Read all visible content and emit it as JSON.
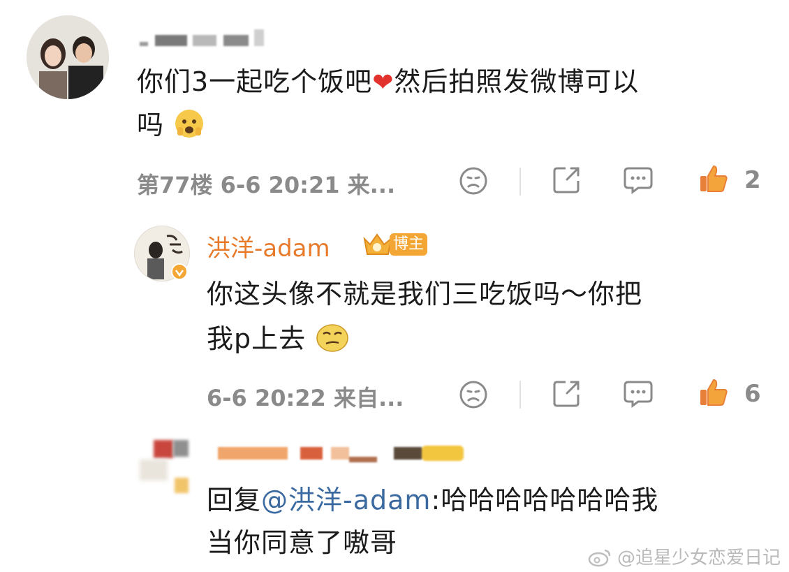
{
  "comments": [
    {
      "text_line1": "你们3一起吃个饭吧",
      "text_line1b": "然后拍照发微博可以",
      "text_line2": "吗",
      "meta": "第77楼 6-6 20:21 来...",
      "likes": "2"
    },
    {
      "author": "洪洋-adam",
      "badge": "博主",
      "text_line1": "你这头像不就是我们三吃饭吗～你把",
      "text_line2": "我p上去",
      "meta": "6-6 20:22 来自...",
      "likes": "6"
    },
    {
      "reply_prefix": "回复",
      "mention": "@洪洋-adam",
      "text_line1_rest": ":哈哈哈哈哈哈哈我",
      "text_line2": "当你同意了嗷哥"
    }
  ],
  "watermark": "@追星少女恋爱日记",
  "colors": {
    "like": "#e8803a",
    "author": "#e77b2b",
    "mention": "#3b6aa0",
    "meta": "#8a8a8a"
  },
  "icons": [
    "dislike-icon",
    "share-icon",
    "comment-icon",
    "like-icon",
    "heart-emoji",
    "fearful-emoji",
    "smirk-emoji",
    "verified-icon",
    "crown-icon",
    "weibo-logo-icon"
  ]
}
